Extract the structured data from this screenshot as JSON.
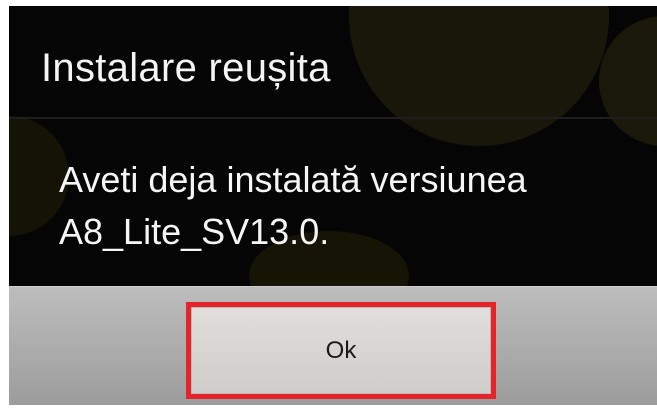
{
  "dialog": {
    "title": "Instalare reușita",
    "message_line1": "Aveti deja instalată versiunea",
    "message_line2": "A8_Lite_SV13.0.",
    "ok_label": "Ok",
    "highlight_color": "#e5232b"
  }
}
